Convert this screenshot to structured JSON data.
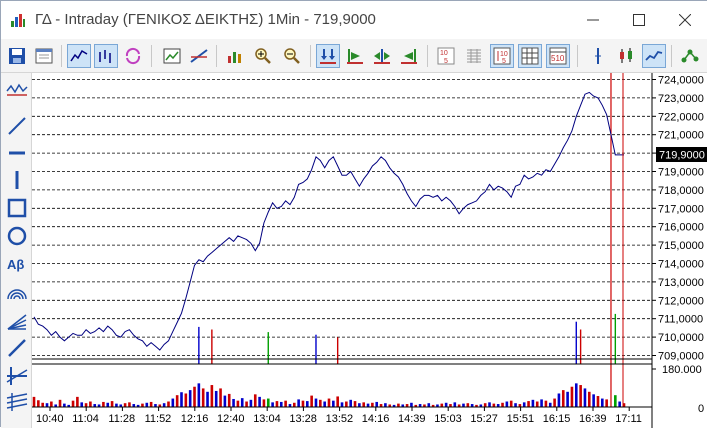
{
  "window": {
    "title": "ΓΔ - Intraday (ΓΕΝΙΚΟΣ ΔΕΙΚΤΗΣ) 1Min - 719,9000",
    "controls": {
      "minimize": "minimize",
      "maximize": "maximize",
      "close": "close"
    }
  },
  "toolbar": {
    "buttons": [
      {
        "name": "save-icon",
        "active": false
      },
      {
        "name": "window-icon",
        "active": false
      },
      {
        "name": "line-chart-mode-icon",
        "active": true
      },
      {
        "name": "bar-chart-mode-icon",
        "active": true
      },
      {
        "name": "refresh-icon",
        "active": false
      },
      {
        "name": "chart-settings-icon",
        "active": false
      },
      {
        "name": "trend-lines-icon",
        "active": false
      },
      {
        "name": "indicators-icon",
        "active": false
      },
      {
        "name": "zoom-in-icon",
        "active": false
      },
      {
        "name": "zoom-out-icon",
        "active": false
      },
      {
        "name": "fit-both-icon",
        "active": true
      },
      {
        "name": "scroll-right-icon",
        "active": false
      },
      {
        "name": "scroll-both-icon",
        "active": false
      },
      {
        "name": "scroll-left-icon",
        "active": false
      },
      {
        "name": "digits-icon",
        "active": false
      },
      {
        "name": "grid-dense-icon",
        "active": false
      },
      {
        "name": "grid-lines-icon",
        "active": true
      },
      {
        "name": "grid-table-icon",
        "active": true
      },
      {
        "name": "grid-numbers-icon",
        "active": true
      },
      {
        "name": "cursor-line-icon",
        "active": false
      },
      {
        "name": "candlestick-icon",
        "active": false
      },
      {
        "name": "line-type-icon",
        "active": true
      },
      {
        "name": "network-icon",
        "active": false
      }
    ],
    "digits_label": "10 5",
    "grid_numbers_label": "5 10"
  },
  "drawing_tools": {
    "text_tool_label": "Αβ"
  },
  "chart_data": {
    "type": "line",
    "price_axis": {
      "ticks": [
        "724,0000",
        "723,0000",
        "722,0000",
        "721,0000",
        "720,0000",
        "719,0000",
        "718,0000",
        "717,0000",
        "716,0000",
        "715,0000",
        "714,0000",
        "713,0000",
        "712,0000",
        "711,0000",
        "710,0000",
        "709,0000"
      ],
      "ylim": [
        709,
        724
      ],
      "current_value": 719.9,
      "current_label": "719,9000"
    },
    "volume_axis": {
      "ticks": [
        "180.000",
        "0"
      ],
      "ylim": [
        0,
        180000
      ]
    },
    "x_ticks": [
      "10:40",
      "11:04",
      "11:28",
      "11:52",
      "12:16",
      "12:40",
      "13:04",
      "13:28",
      "13:52",
      "14:16",
      "14:39",
      "15:03",
      "15:27",
      "15:51",
      "16:15",
      "16:39",
      "17:11"
    ],
    "price_series": [
      [
        0,
        711.1
      ],
      [
        1,
        710.7
      ],
      [
        2,
        710.6
      ],
      [
        3,
        710.4
      ],
      [
        4,
        710.1
      ],
      [
        5,
        710.3
      ],
      [
        6,
        710.0
      ],
      [
        7,
        709.8
      ],
      [
        8,
        710.0
      ],
      [
        9,
        710.2
      ],
      [
        10,
        710.1
      ],
      [
        11,
        710.1
      ],
      [
        12,
        710.4
      ],
      [
        13,
        710.2
      ],
      [
        14,
        710.3
      ],
      [
        15,
        710.5
      ],
      [
        16,
        710.3
      ],
      [
        17,
        710.6
      ],
      [
        18,
        710.4
      ],
      [
        19,
        710.1
      ],
      [
        20,
        710.0
      ],
      [
        21,
        710.3
      ],
      [
        22,
        710.4
      ],
      [
        23,
        710.1
      ],
      [
        24,
        709.9
      ],
      [
        25,
        709.8
      ],
      [
        26,
        709.5
      ],
      [
        27,
        709.7
      ],
      [
        28,
        709.5
      ],
      [
        29,
        709.3
      ],
      [
        30,
        709.6
      ],
      [
        31,
        709.8
      ],
      [
        32,
        710.3
      ],
      [
        33,
        710.8
      ],
      [
        34,
        711.3
      ],
      [
        35,
        712.1
      ],
      [
        36,
        713.0
      ],
      [
        37,
        713.9
      ],
      [
        38,
        714.2
      ],
      [
        39,
        714.1
      ],
      [
        40,
        714.4
      ],
      [
        41,
        714.6
      ],
      [
        42,
        714.8
      ],
      [
        43,
        715.0
      ],
      [
        44,
        715.2
      ],
      [
        45,
        715.4
      ],
      [
        46,
        715.2
      ],
      [
        47,
        715.5
      ],
      [
        48,
        715.4
      ],
      [
        49,
        715.3
      ],
      [
        50,
        715.1
      ],
      [
        51,
        714.7
      ],
      [
        52,
        715.1
      ],
      [
        53,
        716.2
      ],
      [
        54,
        716.8
      ],
      [
        55,
        717.3
      ],
      [
        56,
        717.0
      ],
      [
        57,
        717.1
      ],
      [
        58,
        717.4
      ],
      [
        59,
        717.2
      ],
      [
        60,
        717.6
      ],
      [
        61,
        718.3
      ],
      [
        62,
        718.4
      ],
      [
        63,
        718.6
      ],
      [
        64,
        719.1
      ],
      [
        65,
        719.8
      ],
      [
        66,
        719.6
      ],
      [
        67,
        719.2
      ],
      [
        68,
        719.6
      ],
      [
        69,
        719.8
      ],
      [
        70,
        719.3
      ],
      [
        71,
        718.8
      ],
      [
        72,
        718.8
      ],
      [
        73,
        719.0
      ],
      [
        74,
        718.6
      ],
      [
        75,
        718.2
      ],
      [
        76,
        718.6
      ],
      [
        77,
        718.9
      ],
      [
        78,
        719.3
      ],
      [
        79,
        719.5
      ],
      [
        80,
        719.8
      ],
      [
        81,
        719.6
      ],
      [
        82,
        719.2
      ],
      [
        83,
        718.9
      ],
      [
        84,
        718.7
      ],
      [
        85,
        718.3
      ],
      [
        86,
        717.8
      ],
      [
        87,
        717.4
      ],
      [
        88,
        717.1
      ],
      [
        89,
        717.5
      ],
      [
        90,
        717.7
      ],
      [
        91,
        717.7
      ],
      [
        92,
        717.6
      ],
      [
        93,
        717.7
      ],
      [
        94,
        717.4
      ],
      [
        95,
        717.6
      ],
      [
        96,
        717.4
      ],
      [
        97,
        717.1
      ],
      [
        98,
        716.7
      ],
      [
        99,
        717.0
      ],
      [
        100,
        717.2
      ],
      [
        101,
        717.3
      ],
      [
        102,
        717.4
      ],
      [
        103,
        717.7
      ],
      [
        104,
        717.9
      ],
      [
        105,
        718.3
      ],
      [
        106,
        718.0
      ],
      [
        107,
        718.2
      ],
      [
        108,
        718.1
      ],
      [
        109,
        717.9
      ],
      [
        110,
        717.6
      ],
      [
        111,
        718.2
      ],
      [
        112,
        718.3
      ],
      [
        113,
        718.8
      ],
      [
        114,
        718.6
      ],
      [
        115,
        718.7
      ],
      [
        116,
        718.9
      ],
      [
        117,
        718.8
      ],
      [
        118,
        719.1
      ],
      [
        119,
        719.0
      ],
      [
        120,
        719.4
      ],
      [
        121,
        719.8
      ],
      [
        122,
        720.3
      ],
      [
        123,
        720.7
      ],
      [
        124,
        721.2
      ],
      [
        125,
        722.0
      ],
      [
        126,
        722.6
      ],
      [
        127,
        723.2
      ],
      [
        128,
        723.3
      ],
      [
        129,
        723.1
      ],
      [
        130,
        723.0
      ],
      [
        131,
        722.6
      ],
      [
        132,
        722.1
      ],
      [
        133,
        721.0
      ],
      [
        134,
        719.9
      ],
      [
        135,
        719.9
      ],
      [
        136,
        719.9
      ]
    ],
    "volume_bars": [
      [
        0,
        48000,
        "red"
      ],
      [
        1,
        32000,
        "red"
      ],
      [
        2,
        20000,
        "red"
      ],
      [
        3,
        18000,
        "blue"
      ],
      [
        4,
        26000,
        "red"
      ],
      [
        5,
        12000,
        "blue"
      ],
      [
        6,
        34000,
        "red"
      ],
      [
        7,
        16000,
        "blue"
      ],
      [
        8,
        10000,
        "blue"
      ],
      [
        9,
        30000,
        "red"
      ],
      [
        10,
        48000,
        "red"
      ],
      [
        11,
        22000,
        "blue"
      ],
      [
        12,
        18000,
        "red"
      ],
      [
        13,
        26000,
        "red"
      ],
      [
        14,
        14000,
        "blue"
      ],
      [
        15,
        12000,
        "blue"
      ],
      [
        16,
        24000,
        "red"
      ],
      [
        17,
        20000,
        "blue"
      ],
      [
        18,
        28000,
        "red"
      ],
      [
        19,
        16000,
        "blue"
      ],
      [
        20,
        12000,
        "blue"
      ],
      [
        21,
        18000,
        "red"
      ],
      [
        22,
        22000,
        "red"
      ],
      [
        23,
        14000,
        "blue"
      ],
      [
        24,
        10000,
        "blue"
      ],
      [
        25,
        16000,
        "red"
      ],
      [
        26,
        20000,
        "blue"
      ],
      [
        27,
        24000,
        "red"
      ],
      [
        28,
        14000,
        "blue"
      ],
      [
        29,
        12000,
        "red"
      ],
      [
        30,
        18000,
        "blue"
      ],
      [
        31,
        26000,
        "red"
      ],
      [
        32,
        40000,
        "blue"
      ],
      [
        33,
        56000,
        "red"
      ],
      [
        34,
        70000,
        "blue"
      ],
      [
        35,
        64000,
        "red"
      ],
      [
        36,
        80000,
        "blue"
      ],
      [
        37,
        96000,
        "red"
      ],
      [
        38,
        112000,
        "blue"
      ],
      [
        39,
        88000,
        "red"
      ],
      [
        40,
        72000,
        "blue"
      ],
      [
        41,
        104000,
        "red"
      ],
      [
        42,
        76000,
        "blue"
      ],
      [
        43,
        88000,
        "red"
      ],
      [
        44,
        54000,
        "blue"
      ],
      [
        45,
        62000,
        "red"
      ],
      [
        46,
        38000,
        "blue"
      ],
      [
        47,
        30000,
        "red"
      ],
      [
        48,
        42000,
        "blue"
      ],
      [
        49,
        26000,
        "red"
      ],
      [
        50,
        34000,
        "blue"
      ],
      [
        51,
        60000,
        "red"
      ],
      [
        52,
        48000,
        "blue"
      ],
      [
        53,
        36000,
        "red"
      ],
      [
        54,
        40000,
        "green"
      ],
      [
        55,
        22000,
        "blue"
      ],
      [
        56,
        28000,
        "red"
      ],
      [
        57,
        24000,
        "blue"
      ],
      [
        58,
        30000,
        "red"
      ],
      [
        59,
        14000,
        "blue"
      ],
      [
        60,
        20000,
        "red"
      ],
      [
        61,
        36000,
        "blue"
      ],
      [
        62,
        30000,
        "red"
      ],
      [
        63,
        28000,
        "blue"
      ],
      [
        64,
        54000,
        "red"
      ],
      [
        65,
        40000,
        "blue"
      ],
      [
        66,
        34000,
        "red"
      ],
      [
        67,
        26000,
        "blue"
      ],
      [
        68,
        40000,
        "red"
      ],
      [
        69,
        30000,
        "blue"
      ],
      [
        70,
        50000,
        "red"
      ],
      [
        71,
        22000,
        "blue"
      ],
      [
        72,
        26000,
        "red"
      ],
      [
        73,
        34000,
        "blue"
      ],
      [
        74,
        28000,
        "red"
      ],
      [
        75,
        18000,
        "blue"
      ],
      [
        76,
        22000,
        "red"
      ],
      [
        77,
        16000,
        "blue"
      ],
      [
        78,
        20000,
        "red"
      ],
      [
        79,
        24000,
        "blue"
      ],
      [
        80,
        14000,
        "red"
      ],
      [
        81,
        18000,
        "blue"
      ],
      [
        82,
        12000,
        "red"
      ],
      [
        83,
        10000,
        "blue"
      ],
      [
        84,
        16000,
        "red"
      ],
      [
        85,
        12000,
        "blue"
      ],
      [
        86,
        14000,
        "red"
      ],
      [
        87,
        20000,
        "blue"
      ],
      [
        88,
        10000,
        "red"
      ],
      [
        89,
        14000,
        "blue"
      ],
      [
        90,
        12000,
        "red"
      ],
      [
        91,
        18000,
        "blue"
      ],
      [
        92,
        10000,
        "red"
      ],
      [
        93,
        12000,
        "blue"
      ],
      [
        94,
        16000,
        "red"
      ],
      [
        95,
        20000,
        "blue"
      ],
      [
        96,
        14000,
        "red"
      ],
      [
        97,
        22000,
        "blue"
      ],
      [
        98,
        12000,
        "red"
      ],
      [
        99,
        16000,
        "blue"
      ],
      [
        100,
        18000,
        "red"
      ],
      [
        101,
        14000,
        "blue"
      ],
      [
        102,
        10000,
        "red"
      ],
      [
        103,
        12000,
        "blue"
      ],
      [
        104,
        18000,
        "red"
      ],
      [
        105,
        22000,
        "blue"
      ],
      [
        106,
        16000,
        "red"
      ],
      [
        107,
        14000,
        "blue"
      ],
      [
        108,
        20000,
        "red"
      ],
      [
        109,
        26000,
        "blue"
      ],
      [
        110,
        30000,
        "red"
      ],
      [
        111,
        18000,
        "blue"
      ],
      [
        112,
        14000,
        "red"
      ],
      [
        113,
        22000,
        "blue"
      ],
      [
        114,
        28000,
        "red"
      ],
      [
        115,
        34000,
        "blue"
      ],
      [
        116,
        26000,
        "red"
      ],
      [
        117,
        36000,
        "blue"
      ],
      [
        118,
        30000,
        "red"
      ],
      [
        119,
        20000,
        "blue"
      ],
      [
        120,
        40000,
        "red"
      ],
      [
        121,
        64000,
        "blue"
      ],
      [
        122,
        80000,
        "red"
      ],
      [
        123,
        72000,
        "blue"
      ],
      [
        124,
        96000,
        "red"
      ],
      [
        125,
        112000,
        "blue"
      ],
      [
        126,
        104000,
        "red"
      ],
      [
        127,
        88000,
        "blue"
      ],
      [
        128,
        72000,
        "red"
      ],
      [
        129,
        60000,
        "blue"
      ],
      [
        130,
        52000,
        "red"
      ],
      [
        131,
        40000,
        "blue"
      ],
      [
        132,
        36000,
        "red"
      ],
      [
        133,
        330000,
        "red"
      ],
      [
        134,
        56000,
        "green"
      ],
      [
        135,
        26000,
        "blue"
      ],
      [
        136,
        18000,
        "red"
      ]
    ],
    "grid": true,
    "colors": {
      "price_line": "#000080",
      "blue_bar": "#0000cc",
      "red_bar": "#cc0000",
      "green_bar": "#00a000",
      "cursor_line": "#cc0000"
    }
  }
}
